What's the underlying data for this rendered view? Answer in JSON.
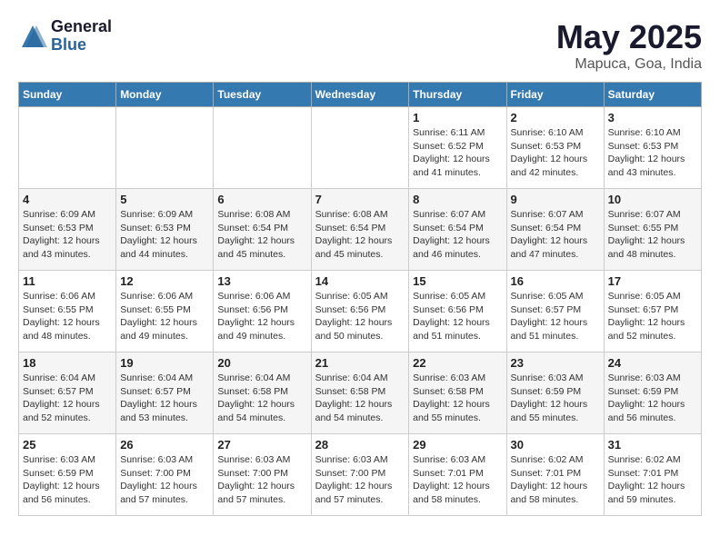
{
  "logo": {
    "general": "General",
    "blue": "Blue"
  },
  "title": "May 2025",
  "subtitle": "Mapuca, Goa, India",
  "days_of_week": [
    "Sunday",
    "Monday",
    "Tuesday",
    "Wednesday",
    "Thursday",
    "Friday",
    "Saturday"
  ],
  "weeks": [
    [
      {
        "day": "",
        "info": ""
      },
      {
        "day": "",
        "info": ""
      },
      {
        "day": "",
        "info": ""
      },
      {
        "day": "",
        "info": ""
      },
      {
        "day": "1",
        "info": "Sunrise: 6:11 AM\nSunset: 6:52 PM\nDaylight: 12 hours and 41 minutes."
      },
      {
        "day": "2",
        "info": "Sunrise: 6:10 AM\nSunset: 6:53 PM\nDaylight: 12 hours and 42 minutes."
      },
      {
        "day": "3",
        "info": "Sunrise: 6:10 AM\nSunset: 6:53 PM\nDaylight: 12 hours and 43 minutes."
      }
    ],
    [
      {
        "day": "4",
        "info": "Sunrise: 6:09 AM\nSunset: 6:53 PM\nDaylight: 12 hours and 43 minutes."
      },
      {
        "day": "5",
        "info": "Sunrise: 6:09 AM\nSunset: 6:53 PM\nDaylight: 12 hours and 44 minutes."
      },
      {
        "day": "6",
        "info": "Sunrise: 6:08 AM\nSunset: 6:54 PM\nDaylight: 12 hours and 45 minutes."
      },
      {
        "day": "7",
        "info": "Sunrise: 6:08 AM\nSunset: 6:54 PM\nDaylight: 12 hours and 45 minutes."
      },
      {
        "day": "8",
        "info": "Sunrise: 6:07 AM\nSunset: 6:54 PM\nDaylight: 12 hours and 46 minutes."
      },
      {
        "day": "9",
        "info": "Sunrise: 6:07 AM\nSunset: 6:54 PM\nDaylight: 12 hours and 47 minutes."
      },
      {
        "day": "10",
        "info": "Sunrise: 6:07 AM\nSunset: 6:55 PM\nDaylight: 12 hours and 48 minutes."
      }
    ],
    [
      {
        "day": "11",
        "info": "Sunrise: 6:06 AM\nSunset: 6:55 PM\nDaylight: 12 hours and 48 minutes."
      },
      {
        "day": "12",
        "info": "Sunrise: 6:06 AM\nSunset: 6:55 PM\nDaylight: 12 hours and 49 minutes."
      },
      {
        "day": "13",
        "info": "Sunrise: 6:06 AM\nSunset: 6:56 PM\nDaylight: 12 hours and 49 minutes."
      },
      {
        "day": "14",
        "info": "Sunrise: 6:05 AM\nSunset: 6:56 PM\nDaylight: 12 hours and 50 minutes."
      },
      {
        "day": "15",
        "info": "Sunrise: 6:05 AM\nSunset: 6:56 PM\nDaylight: 12 hours and 51 minutes."
      },
      {
        "day": "16",
        "info": "Sunrise: 6:05 AM\nSunset: 6:57 PM\nDaylight: 12 hours and 51 minutes."
      },
      {
        "day": "17",
        "info": "Sunrise: 6:05 AM\nSunset: 6:57 PM\nDaylight: 12 hours and 52 minutes."
      }
    ],
    [
      {
        "day": "18",
        "info": "Sunrise: 6:04 AM\nSunset: 6:57 PM\nDaylight: 12 hours and 52 minutes."
      },
      {
        "day": "19",
        "info": "Sunrise: 6:04 AM\nSunset: 6:57 PM\nDaylight: 12 hours and 53 minutes."
      },
      {
        "day": "20",
        "info": "Sunrise: 6:04 AM\nSunset: 6:58 PM\nDaylight: 12 hours and 54 minutes."
      },
      {
        "day": "21",
        "info": "Sunrise: 6:04 AM\nSunset: 6:58 PM\nDaylight: 12 hours and 54 minutes."
      },
      {
        "day": "22",
        "info": "Sunrise: 6:03 AM\nSunset: 6:58 PM\nDaylight: 12 hours and 55 minutes."
      },
      {
        "day": "23",
        "info": "Sunrise: 6:03 AM\nSunset: 6:59 PM\nDaylight: 12 hours and 55 minutes."
      },
      {
        "day": "24",
        "info": "Sunrise: 6:03 AM\nSunset: 6:59 PM\nDaylight: 12 hours and 56 minutes."
      }
    ],
    [
      {
        "day": "25",
        "info": "Sunrise: 6:03 AM\nSunset: 6:59 PM\nDaylight: 12 hours and 56 minutes."
      },
      {
        "day": "26",
        "info": "Sunrise: 6:03 AM\nSunset: 7:00 PM\nDaylight: 12 hours and 57 minutes."
      },
      {
        "day": "27",
        "info": "Sunrise: 6:03 AM\nSunset: 7:00 PM\nDaylight: 12 hours and 57 minutes."
      },
      {
        "day": "28",
        "info": "Sunrise: 6:03 AM\nSunset: 7:00 PM\nDaylight: 12 hours and 57 minutes."
      },
      {
        "day": "29",
        "info": "Sunrise: 6:03 AM\nSunset: 7:01 PM\nDaylight: 12 hours and 58 minutes."
      },
      {
        "day": "30",
        "info": "Sunrise: 6:02 AM\nSunset: 7:01 PM\nDaylight: 12 hours and 58 minutes."
      },
      {
        "day": "31",
        "info": "Sunrise: 6:02 AM\nSunset: 7:01 PM\nDaylight: 12 hours and 59 minutes."
      }
    ]
  ]
}
